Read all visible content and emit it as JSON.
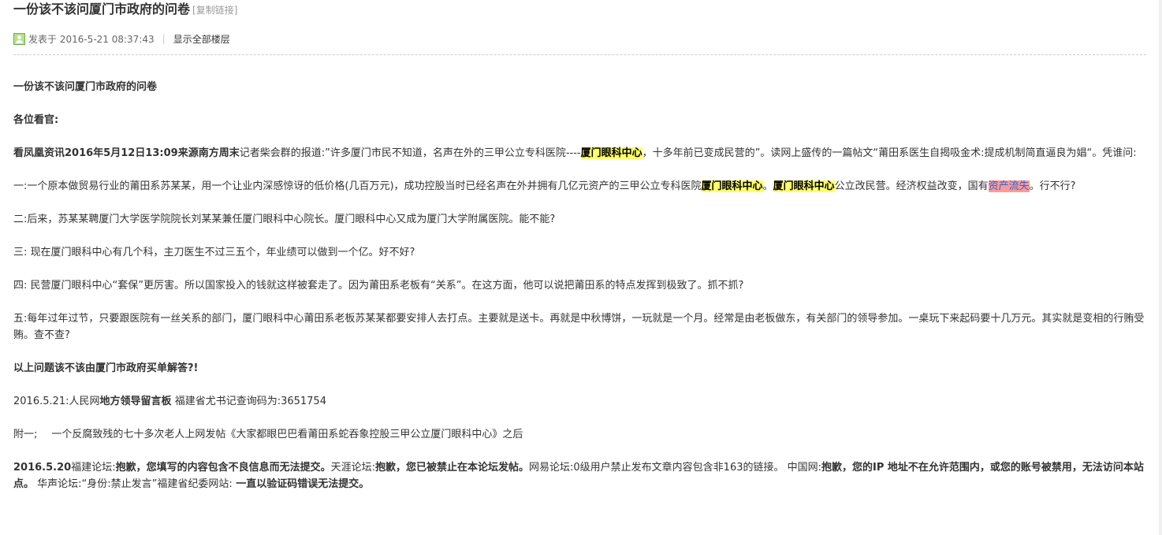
{
  "thread": {
    "title": "一份该不该问厦门市政府的问卷",
    "copy_link": "[复制链接]",
    "posted": "发表于 2016-5-21 08:37:43",
    "separator": "|",
    "show_all": "显示全部楼层"
  },
  "post": {
    "heading": "一份该不该问厦门市政府的问卷",
    "greeting": "各位看官:",
    "p1": {
      "a": "看凤凰资讯2016年5月12日13:09来源南方周末",
      "b": "记者柴会群的报道:”许多厦门市民不知道，名声在外的三甲公立专科医院----",
      "hl": "厦门眼科中心",
      "c": "，十多年前已变成民营的”。读网上盛传的一篇帖文“莆田系医生自揭吸金术:提成机制简直逼良为娼“。凭谁问:"
    },
    "q1": {
      "a": "一:一个原本做贸易行业的莆田系苏某某，用一个让业内深感惊讶的低价格(几百万元)，成功控股当时已经名声在外并拥有几亿元资产的三甲公立专科医院",
      "hl1": "厦门眼科中心",
      "b": "。",
      "hl2": "厦门眼科中心",
      "c": "公立改民营。经济权益改变，国有",
      "hl3": "资产流失",
      "d": "。行不行?"
    },
    "q2": "二:后来，苏某某聘厦门大学医学院院长刘某某兼任厦门眼科中心院长。厦门眼科中心又成为厦门大学附属医院。能不能?",
    "q3": "三: 现在厦门眼科中心有几个科，主刀医生不过三五个，年业绩可以做到一个亿。好不好?",
    "q4": "四: 民营厦门眼科中心“套保”更厉害。所以国家投入的钱就这样被套走了。因为莆田系老板有“关系”。在这方面，他可以说把莆田系的特点发挥到极致了。抓不抓?",
    "q5": "五:每年过年过节，只要跟医院有一丝关系的部门，厦门眼科中心莆田系老板苏某某都要安排人去打点。主要就是送卡。再就是中秋博饼，一玩就是一个月。经常是由老板做东，有关部门的领导参加。一桌玩下来起码要十几万元。其实就是变相的行贿受贿。查不查?",
    "conclusion": "以上问题该不该由厦门市政府买单解答?!",
    "note": {
      "a": "2016.5.21:人民网",
      "b": "地方领导留言板",
      "c": " 福建省尤书记查询码为:3651754"
    },
    "appendix": {
      "a": "附一;",
      "b": "一个反腐致残的七十多次老人上网发帖《大家都眼巴巴看莆田系蛇吞象控股三甲公立厦门眼科中心》之后"
    },
    "forums": {
      "a": "2016.5.20",
      "b": "福建论坛:",
      "c": "抱歉，您填写的内容包含不良信息而无法提交。",
      "d": "天涯论坛:",
      "e": "抱歉，您已被禁止在本论坛发帖。",
      "f": "网易论坛:",
      "g": "0级用户禁止发布文章内容包含非163的链接。",
      "h": " 中国网:",
      "i": "抱歉，您的IP 地址不在允许范围内，或您的账号被禁用，无法访问本站点。",
      "j": " 华声论坛:",
      "k": "“身份:禁止发言”",
      "l": "福建省纪委网站:",
      "m": " 一直以验证码错误无法提交。"
    }
  }
}
